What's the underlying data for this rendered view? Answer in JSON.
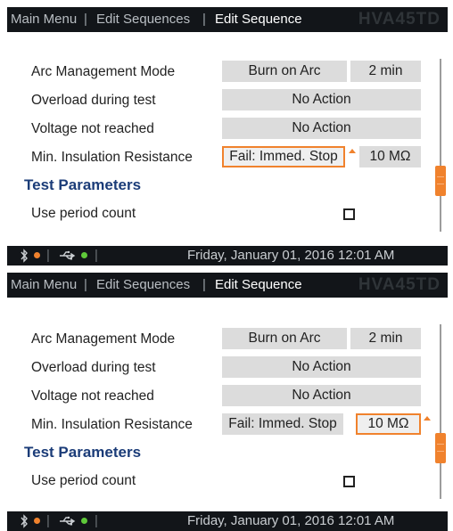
{
  "screens": [
    {
      "breadcrumbs": [
        "Main Menu",
        "Edit Sequences",
        "Edit Sequence"
      ],
      "separator": "|",
      "device_name": "HVA45TD",
      "rows": [
        {
          "label": "Arc Management Mode",
          "value": "Burn on Arc",
          "secondary": "2 min"
        },
        {
          "label": "Overload during test",
          "value": "No Action"
        },
        {
          "label": "Voltage not reached",
          "value": "No Action"
        },
        {
          "label": "Min. Insulation Resistance",
          "value": "Fail: Immed. Stop",
          "secondary": "10 MΩ",
          "selected_field": "value"
        }
      ],
      "section_title": "Test Parameters",
      "checkbox_row": {
        "label": "Use period count",
        "checked": false
      },
      "status": {
        "bluetooth_icon": "bluetooth-icon",
        "usb_icon": "usb-icon",
        "bluetooth_dot_color": "#f0822d",
        "usb_dot_color": "#5fc93a",
        "datetime": "Friday, January 01, 2016 12:01 AM"
      }
    },
    {
      "breadcrumbs": [
        "Main Menu",
        "Edit Sequences",
        "Edit Sequence"
      ],
      "separator": "|",
      "device_name": "HVA45TD",
      "rows": [
        {
          "label": "Arc Management Mode",
          "value": "Burn on Arc",
          "secondary": "2 min"
        },
        {
          "label": "Overload during test",
          "value": "No Action"
        },
        {
          "label": "Voltage not reached",
          "value": "No Action"
        },
        {
          "label": "Min. Insulation Resistance",
          "value": "Fail: Immed. Stop",
          "secondary": "10 MΩ",
          "selected_field": "secondary"
        }
      ],
      "section_title": "Test Parameters",
      "checkbox_row": {
        "label": "Use period count",
        "checked": false
      },
      "status": {
        "bluetooth_icon": "bluetooth-icon",
        "usb_icon": "usb-icon",
        "bluetooth_dot_color": "#f0822d",
        "usb_dot_color": "#5fc93a",
        "datetime": "Friday, January 01, 2016 12:01 AM"
      }
    }
  ],
  "theme": {
    "accent": "#f0822d",
    "section_color": "#1b3c78",
    "bar_color": "#121519",
    "field_color": "#dcdcdc"
  }
}
